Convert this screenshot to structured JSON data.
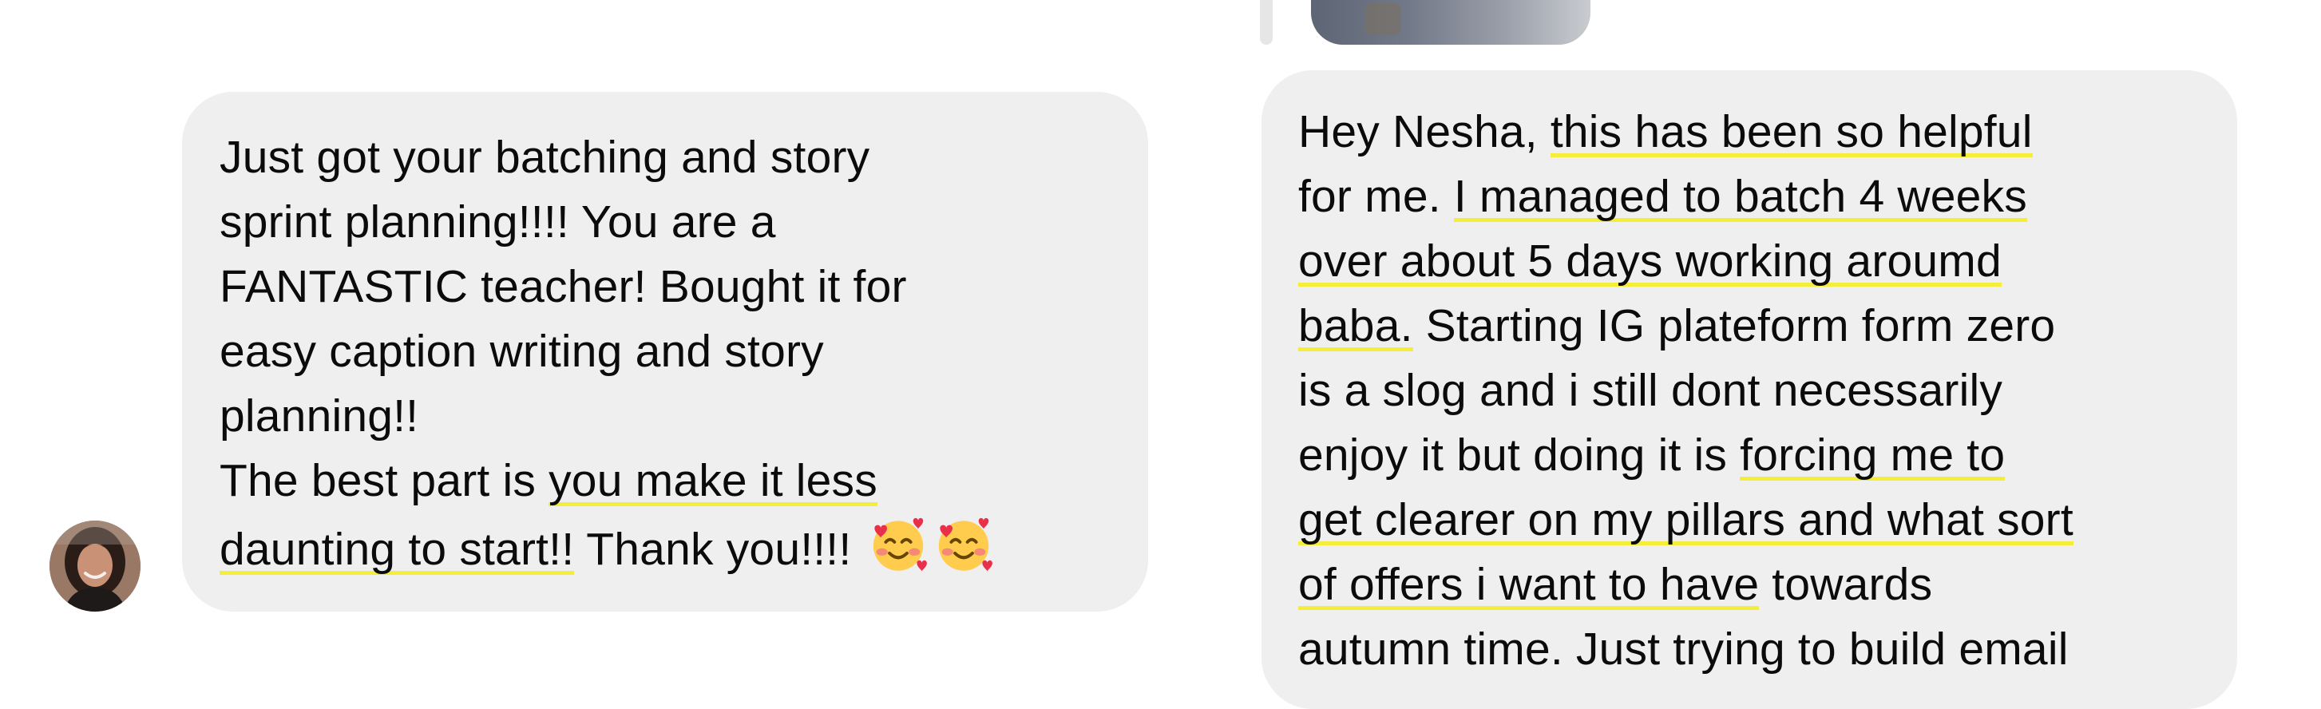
{
  "left_message": {
    "lines": [
      {
        "text": "Just got your batching and story"
      },
      {
        "text": "sprint planning!!!! You are a"
      },
      {
        "text": "FANTASTIC teacher! Bought it for"
      },
      {
        "text": "easy caption writing and story"
      },
      {
        "text": "planning!!"
      },
      {
        "pre": "The best part is ",
        "highlight": "you make it less"
      },
      {
        "highlight": "daunting to start!!",
        "post": " Thank you!!!! "
      }
    ],
    "emoji": [
      "🥰",
      "🥰"
    ]
  },
  "right_message": {
    "lines": [
      {
        "pre": "Hey Nesha, ",
        "highlight": "this has been so helpful"
      },
      {
        "pre": "for me. ",
        "highlight": "I managed to batch 4 weeks"
      },
      {
        "highlight": "over about 5 days working aroumd"
      },
      {
        "highlight": "baba.",
        "post": " Starting IG plateform form zero"
      },
      {
        "pre": "is a slog and i still dont necessarily"
      },
      {
        "pre": "enjoy it but doing it is ",
        "highlight": "forcing me to"
      },
      {
        "highlight": "get clearer on my pillars and what sort"
      },
      {
        "highlight": "of offers i want to have",
        "post": " towards"
      },
      {
        "pre": "autumn time. Just trying to build email"
      }
    ]
  },
  "colors": {
    "bubble": "#efefef",
    "highlight": "#f4ee3a",
    "text": "#0b0b0b"
  },
  "icons": {
    "emoji": "smiling-face-with-hearts-icon",
    "avatar": "user-avatar"
  }
}
